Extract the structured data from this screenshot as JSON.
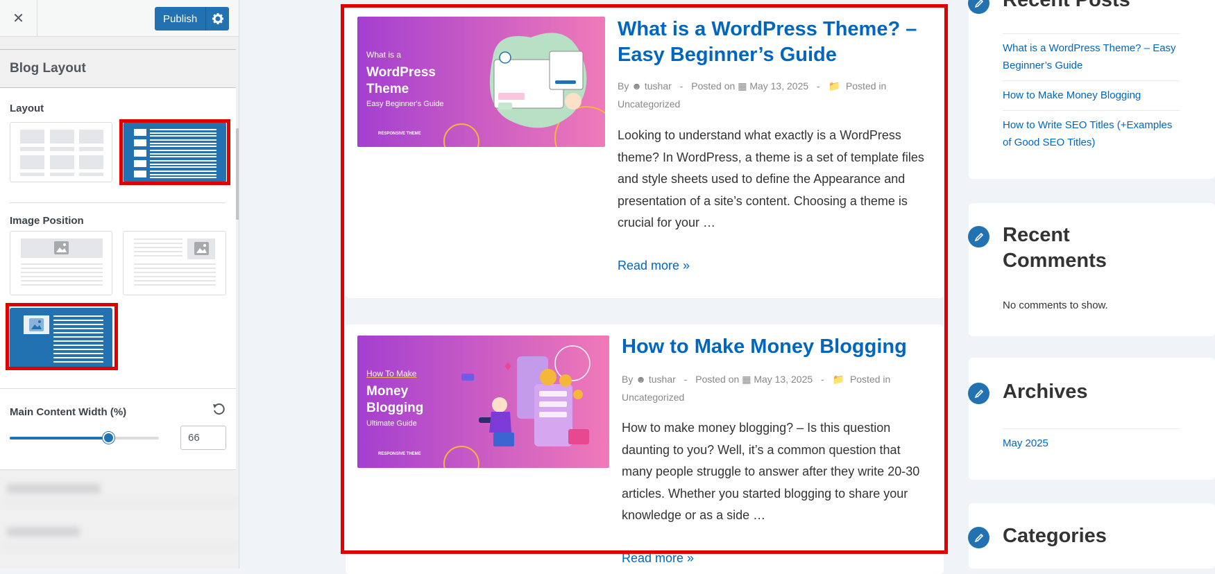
{
  "customizer": {
    "close_label": "✕",
    "publish_label": "Publish",
    "section_title": "Blog Layout",
    "layout_label": "Layout",
    "image_position_label": "Image Position",
    "main_width_label": "Main Content Width (%)",
    "main_width_value": "66",
    "main_width_fraction": 0.66,
    "selected_layout": "list",
    "selected_image_position": "left"
  },
  "posts": [
    {
      "title": "What is a WordPress Theme? – Easy Beginner’s Guide",
      "by": "By",
      "author": "tushar",
      "sep1": "-",
      "posted_on": "Posted on",
      "date": "May 13, 2025",
      "sep2": "-",
      "posted_in": "Posted in",
      "category": "Uncategorized",
      "excerpt": "Looking to understand what exactly is a WordPress theme? In WordPress, a theme is a set of template files and style sheets used to define the Appearance and presentation of a site’s content.  Choosing a theme is crucial for your …",
      "read_more": "Read more »",
      "image": {
        "line1": "What is a",
        "line2": "WordPress",
        "line3": "Theme",
        "line4": "Easy Beginner's Guide",
        "brand": "RESPONSIVE THEME"
      }
    },
    {
      "title": "How to Make Money Blogging",
      "by": "By",
      "author": "tushar",
      "sep1": "-",
      "posted_on": "Posted on",
      "date": "May 13, 2025",
      "sep2": "-",
      "posted_in": "Posted in",
      "category": "Uncategorized",
      "excerpt": "How to make money blogging? – Is this question daunting to you? Well, it’s a common question that many people struggle to answer after they write 20-30 articles. Whether you started blogging to share your knowledge or as a side …",
      "read_more": "Read more »",
      "image": {
        "line1": "How To Make",
        "line2": "Money",
        "line3": "Blogging",
        "line4": "Ultimate Guide",
        "brand": "RESPONSIVE THEME"
      }
    }
  ],
  "sidebar": {
    "recent_posts": {
      "title": "Recent Posts",
      "items": [
        "What is a WordPress Theme? – Easy Beginner’s Guide",
        "How to Make Money Blogging",
        "How to Write SEO Titles (+Examples of Good SEO Titles)"
      ]
    },
    "recent_comments": {
      "title": "Recent Comments",
      "empty": "No comments to show."
    },
    "archives": {
      "title": "Archives",
      "items": [
        "May 2025"
      ]
    },
    "categories": {
      "title": "Categories"
    }
  },
  "colors": {
    "accent": "#2271b1",
    "link": "#0066bf",
    "highlight": "#e00000",
    "image_gradient_start": "#a43fd0",
    "image_gradient_end": "#f07ab8"
  }
}
